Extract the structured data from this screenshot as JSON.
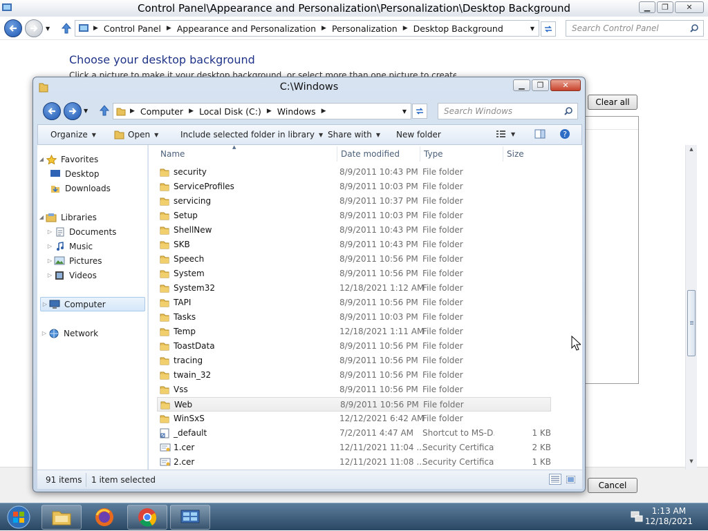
{
  "background_window": {
    "title": "Control Panel\\Appearance and Personalization\\Personalization\\Desktop Background",
    "breadcrumbs": [
      "Control Panel",
      "Appearance and Personalization",
      "Personalization",
      "Desktop Background"
    ],
    "search_placeholder": "Search Control Panel",
    "heading": "Choose your desktop background",
    "description": "Click a picture to make it your desktop background, or select more than one picture to create a slide show.",
    "clear_all_label": "Clear all",
    "cancel_label": "Cancel"
  },
  "dialog": {
    "title": "C:\\Windows",
    "breadcrumbs": [
      "Computer",
      "Local Disk (C:)",
      "Windows"
    ],
    "search_placeholder": "Search Windows",
    "commands": {
      "organize": "Organize",
      "open": "Open",
      "include": "Include selected folder in library",
      "share": "Share with",
      "new_folder": "New folder"
    },
    "nav": {
      "favorites": "Favorites",
      "desktop": "Desktop",
      "downloads": "Downloads",
      "libraries": "Libraries",
      "documents": "Documents",
      "music": "Music",
      "pictures": "Pictures",
      "videos": "Videos",
      "computer": "Computer",
      "network": "Network"
    },
    "columns": {
      "name": "Name",
      "date": "Date modified",
      "type": "Type",
      "size": "Size"
    },
    "files": [
      {
        "name": "security",
        "date": "8/9/2011 10:43 PM",
        "type": "File folder",
        "size": ""
      },
      {
        "name": "ServiceProfiles",
        "date": "8/9/2011 10:03 PM",
        "type": "File folder",
        "size": ""
      },
      {
        "name": "servicing",
        "date": "8/9/2011 10:37 PM",
        "type": "File folder",
        "size": ""
      },
      {
        "name": "Setup",
        "date": "8/9/2011 10:03 PM",
        "type": "File folder",
        "size": ""
      },
      {
        "name": "ShellNew",
        "date": "8/9/2011 10:43 PM",
        "type": "File folder",
        "size": ""
      },
      {
        "name": "SKB",
        "date": "8/9/2011 10:43 PM",
        "type": "File folder",
        "size": ""
      },
      {
        "name": "Speech",
        "date": "8/9/2011 10:56 PM",
        "type": "File folder",
        "size": ""
      },
      {
        "name": "System",
        "date": "8/9/2011 10:56 PM",
        "type": "File folder",
        "size": ""
      },
      {
        "name": "System32",
        "date": "12/18/2021 1:12 AM",
        "type": "File folder",
        "size": ""
      },
      {
        "name": "TAPI",
        "date": "8/9/2011 10:56 PM",
        "type": "File folder",
        "size": ""
      },
      {
        "name": "Tasks",
        "date": "8/9/2011 10:03 PM",
        "type": "File folder",
        "size": ""
      },
      {
        "name": "Temp",
        "date": "12/18/2021 1:11 AM",
        "type": "File folder",
        "size": ""
      },
      {
        "name": "ToastData",
        "date": "8/9/2011 10:56 PM",
        "type": "File folder",
        "size": ""
      },
      {
        "name": "tracing",
        "date": "8/9/2011 10:56 PM",
        "type": "File folder",
        "size": ""
      },
      {
        "name": "twain_32",
        "date": "8/9/2011 10:56 PM",
        "type": "File folder",
        "size": ""
      },
      {
        "name": "Vss",
        "date": "8/9/2011 10:56 PM",
        "type": "File folder",
        "size": ""
      },
      {
        "name": "Web",
        "date": "8/9/2011 10:56 PM",
        "type": "File folder",
        "size": "",
        "selected": true
      },
      {
        "name": "WinSxS",
        "date": "12/12/2021 6:42 AM",
        "type": "File folder",
        "size": ""
      },
      {
        "name": "_default",
        "date": "7/2/2011 4:47 AM",
        "type": "Shortcut to MS-D...",
        "size": "1 KB",
        "icon": "shortcut-icon"
      },
      {
        "name": "1.cer",
        "date": "12/11/2021 11:04 ...",
        "type": "Security Certificate",
        "size": "2 KB",
        "icon": "certificate-icon"
      },
      {
        "name": "2.cer",
        "date": "12/11/2021 11:08 ...",
        "type": "Security Certificate",
        "size": "1 KB",
        "icon": "certificate-icon"
      }
    ],
    "status": {
      "count": "91 items",
      "selected": "1 item selected"
    }
  },
  "taskbar": {
    "time": "1:13 AM",
    "date": "12/18/2021",
    "apps": [
      "file-explorer-icon",
      "firefox-icon",
      "chrome-icon",
      "control-panel-icon"
    ]
  },
  "colors": {
    "folder": "#e9c15a",
    "heading": "#1e3287",
    "selection": "#ececec"
  }
}
